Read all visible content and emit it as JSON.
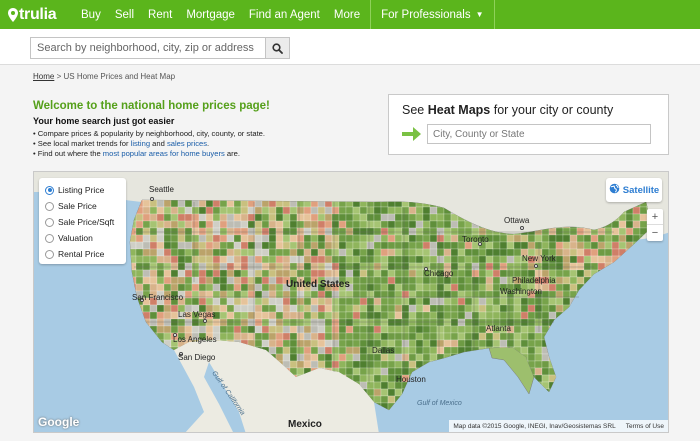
{
  "brand": {
    "name": "trulia",
    "color": "#5bb51c"
  },
  "nav": {
    "items": [
      "Buy",
      "Sell",
      "Rent",
      "Mortgage",
      "Find an Agent",
      "More"
    ],
    "professionals": "For Professionals"
  },
  "search": {
    "placeholder": "Search by neighborhood, city, zip or address",
    "icon": "search-icon"
  },
  "breadcrumb": {
    "home": "Home",
    "separator": ">",
    "current": "US Home Prices and Heat Map"
  },
  "welcome": {
    "title": "Welcome to the national home prices page!",
    "subtitle": "Your home search just got easier",
    "bullet1": "Compare prices & popularity by neighborhood, city, county, or state.",
    "bullet2_pre": "See local market trends for ",
    "bullet2_link1": "listing",
    "bullet2_mid": " and ",
    "bullet2_link2": "sales prices",
    "bullet2_post": ".",
    "bullet3_pre": "Find out where the ",
    "bullet3_link": "most popular areas for home buyers",
    "bullet3_post": " are."
  },
  "heatmap_box": {
    "title_pre": "See ",
    "title_bold": "Heat Maps",
    "title_post": " for your city or county",
    "placeholder": "City, County or State"
  },
  "map": {
    "options": [
      {
        "label": "Listing Price",
        "selected": true
      },
      {
        "label": "Sale Price",
        "selected": false
      },
      {
        "label": "Sale Price/Sqft",
        "selected": false
      },
      {
        "label": "Valuation",
        "selected": false
      },
      {
        "label": "Rental Price",
        "selected": false
      }
    ],
    "satellite": "Satellite",
    "zoom_in": "+",
    "zoom_out": "−",
    "labels": {
      "seattle": "Seattle",
      "ottawa": "Ottawa",
      "toronto": "Toronto",
      "chicago": "Chicago",
      "new_york": "New York",
      "united_states": "United States",
      "san_francisco": "San Francisco",
      "las_vegas": "Las Vegas",
      "los_angeles": "Los Angeles",
      "san_diego": "San Diego",
      "dallas": "Dallas",
      "houston": "Houston",
      "atlanta": "Atlanta",
      "philadelphia": "Philadelphia",
      "washington": "Washington",
      "mexico": "Mexico",
      "gulf_of_california": "Gulf of California",
      "gulf_of_mexico": "Gulf of Mexico"
    },
    "logo": "Google",
    "attribution": "Map data ©2015 Google, INEGI, Inav/Geosistemas SRL",
    "terms": "Terms of Use"
  }
}
